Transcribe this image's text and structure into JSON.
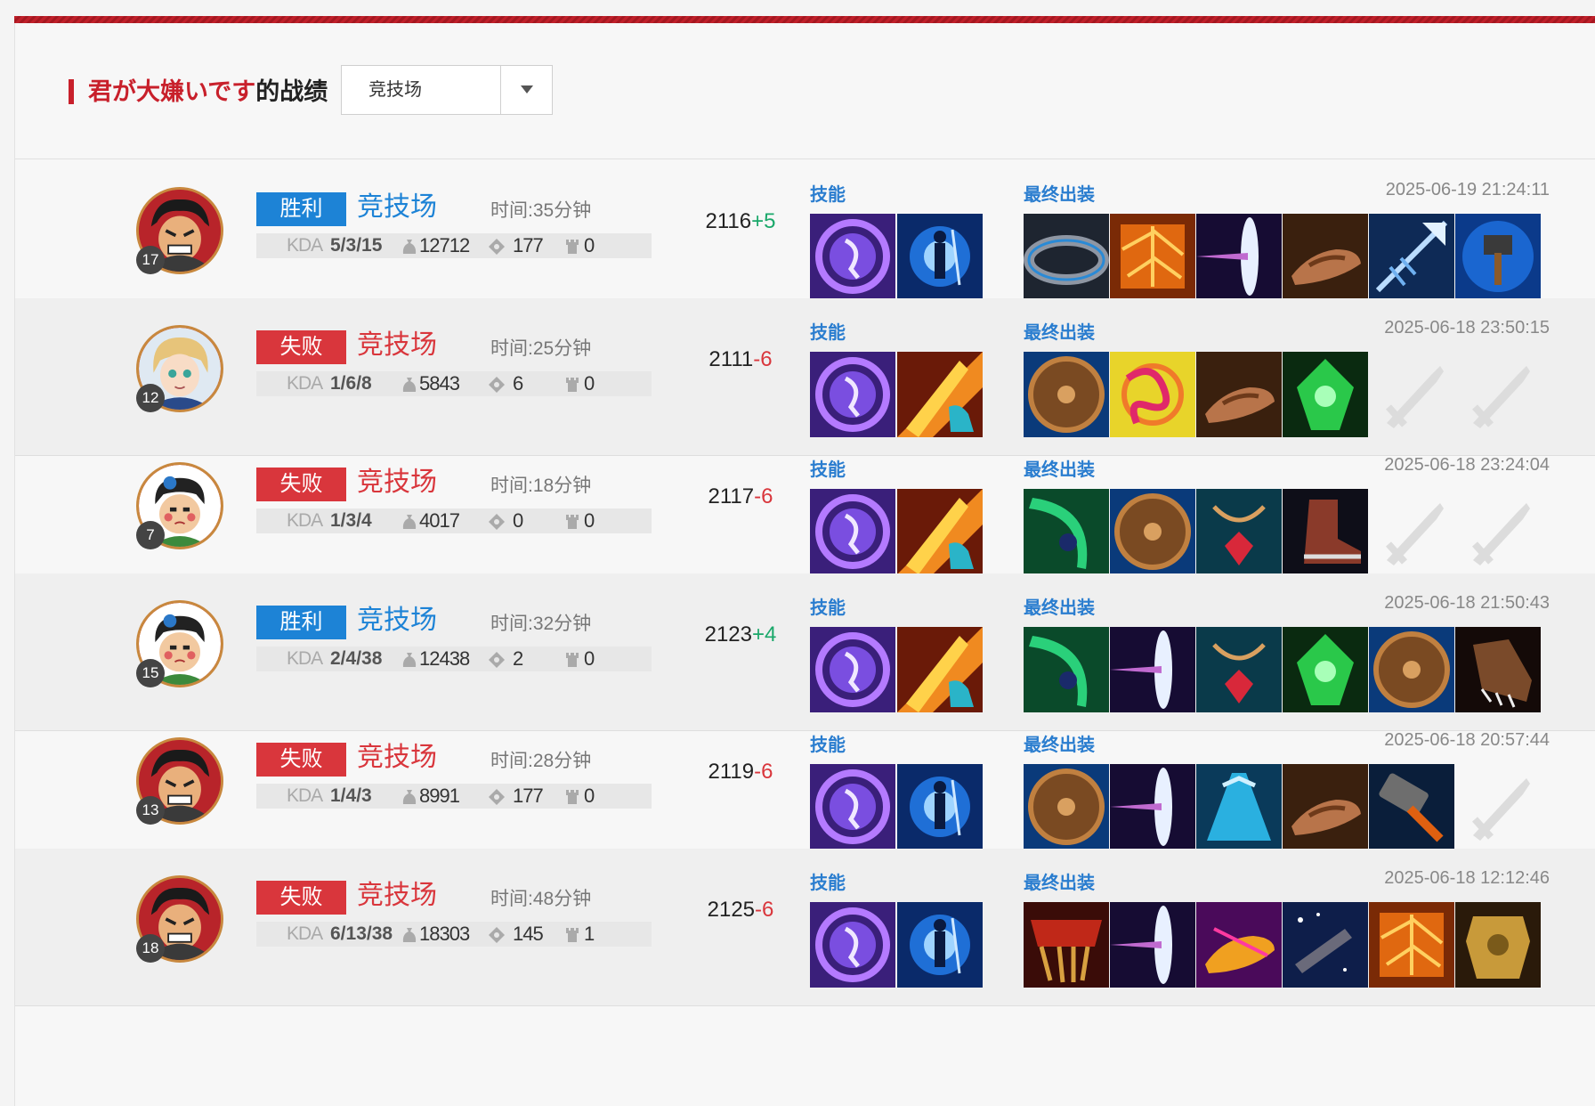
{
  "header": {
    "nickname": "君が大嫌いです",
    "suffix": "的战绩",
    "mode_select": {
      "selected": "竞技场"
    }
  },
  "labels": {
    "skills": "技能",
    "items": "最终出装",
    "kda": "KDA"
  },
  "colors": {
    "accent_red": "#c8202b",
    "win_blue": "#1d83d6",
    "lose_red": "#d9363c",
    "gain_green": "#1aa86a",
    "label_blue": "#2a7dcf"
  },
  "matches": [
    {
      "hero_icon": "hero-angry-warrior-icon",
      "level": "17",
      "result": "胜利",
      "outcome": "win",
      "mode": "竞技场",
      "duration": "时间:35分钟",
      "kda": "5/3/15",
      "gold": "12712",
      "kills_stat": "177",
      "towers": "0",
      "score": "2116",
      "delta": "+5",
      "date": "2025-06-19 21:24:11",
      "skills": [
        "purple-dash-skill-icon",
        "blue-figure-skill-icon"
      ],
      "items": [
        "steel-ring-item-icon",
        "molten-armor-item-icon",
        "light-blade-item-icon",
        "sandal-item-icon",
        "ice-spear-item-icon",
        "blue-hammer-item-icon"
      ]
    },
    {
      "hero_icon": "hero-blonde-boy-icon",
      "level": "12",
      "result": "失败",
      "outcome": "lose",
      "mode": "竞技场",
      "duration": "时间:25分钟",
      "kda": "1/6/8",
      "gold": "5843",
      "kills_stat": "6",
      "towers": "0",
      "score": "2111",
      "delta": "-6",
      "date": "2025-06-18 23:50:15",
      "skills": [
        "purple-dash-skill-icon",
        "fire-hand-skill-icon"
      ],
      "items": [
        "wood-shield-item-icon",
        "spiral-charm-item-icon",
        "sandal-item-icon",
        "green-crystal-item-icon",
        "empty-slot-icon",
        "empty-slot-icon"
      ]
    },
    {
      "hero_icon": "hero-red-cheek-boy-icon",
      "level": "7",
      "result": "失败",
      "outcome": "lose",
      "mode": "竞技场",
      "duration": "时间:18分钟",
      "kda": "1/3/4",
      "gold": "4017",
      "kills_stat": "0",
      "towers": "0",
      "score": "2117",
      "delta": "-6",
      "date": "2025-06-18 23:24:04",
      "skills": [
        "purple-dash-skill-icon",
        "fire-hand-skill-icon"
      ],
      "items": [
        "green-scythe-item-icon",
        "wood-shield-item-icon",
        "ruby-amulet-item-icon",
        "leather-boot-item-icon",
        "empty-slot-icon",
        "empty-slot-icon"
      ]
    },
    {
      "hero_icon": "hero-red-cheek-boy-icon",
      "level": "15",
      "result": "胜利",
      "outcome": "win",
      "mode": "竞技场",
      "duration": "时间:32分钟",
      "kda": "2/4/38",
      "gold": "12438",
      "kills_stat": "2",
      "towers": "0",
      "score": "2123",
      "delta": "+4",
      "date": "2025-06-18 21:50:43",
      "skills": [
        "purple-dash-skill-icon",
        "fire-hand-skill-icon"
      ],
      "items": [
        "green-scythe-item-icon",
        "light-blade-item-icon",
        "ruby-amulet-item-icon",
        "green-crystal-item-icon",
        "wood-shield-item-icon",
        "spiked-boot-item-icon"
      ]
    },
    {
      "hero_icon": "hero-angry-warrior-icon",
      "level": "13",
      "result": "失败",
      "outcome": "lose",
      "mode": "竞技场",
      "duration": "时间:28分钟",
      "kda": "1/4/3",
      "gold": "8991",
      "kills_stat": "177",
      "towers": "0",
      "score": "2119",
      "delta": "-6",
      "date": "2025-06-18 20:57:44",
      "skills": [
        "purple-dash-skill-icon",
        "blue-figure-skill-icon"
      ],
      "items": [
        "wood-shield-item-icon",
        "light-blade-item-icon",
        "blue-cloak-item-icon",
        "sandal-item-icon",
        "iron-hammer-item-icon",
        "empty-slot-icon"
      ]
    },
    {
      "hero_icon": "hero-angry-warrior-icon",
      "level": "18",
      "result": "失败",
      "outcome": "lose",
      "mode": "竞技场",
      "duration": "时间:48分钟",
      "kda": "6/13/38",
      "gold": "18303",
      "kills_stat": "145",
      "towers": "1",
      "score": "2125",
      "delta": "-6",
      "date": "2025-06-18 12:12:46",
      "skills": [
        "purple-dash-skill-icon",
        "blue-figure-skill-icon"
      ],
      "items": [
        "red-belt-item-icon",
        "light-blade-item-icon",
        "golden-sandal-item-icon",
        "starry-cannon-item-icon",
        "molten-armor-item-icon",
        "gold-armor-item-icon"
      ]
    }
  ]
}
